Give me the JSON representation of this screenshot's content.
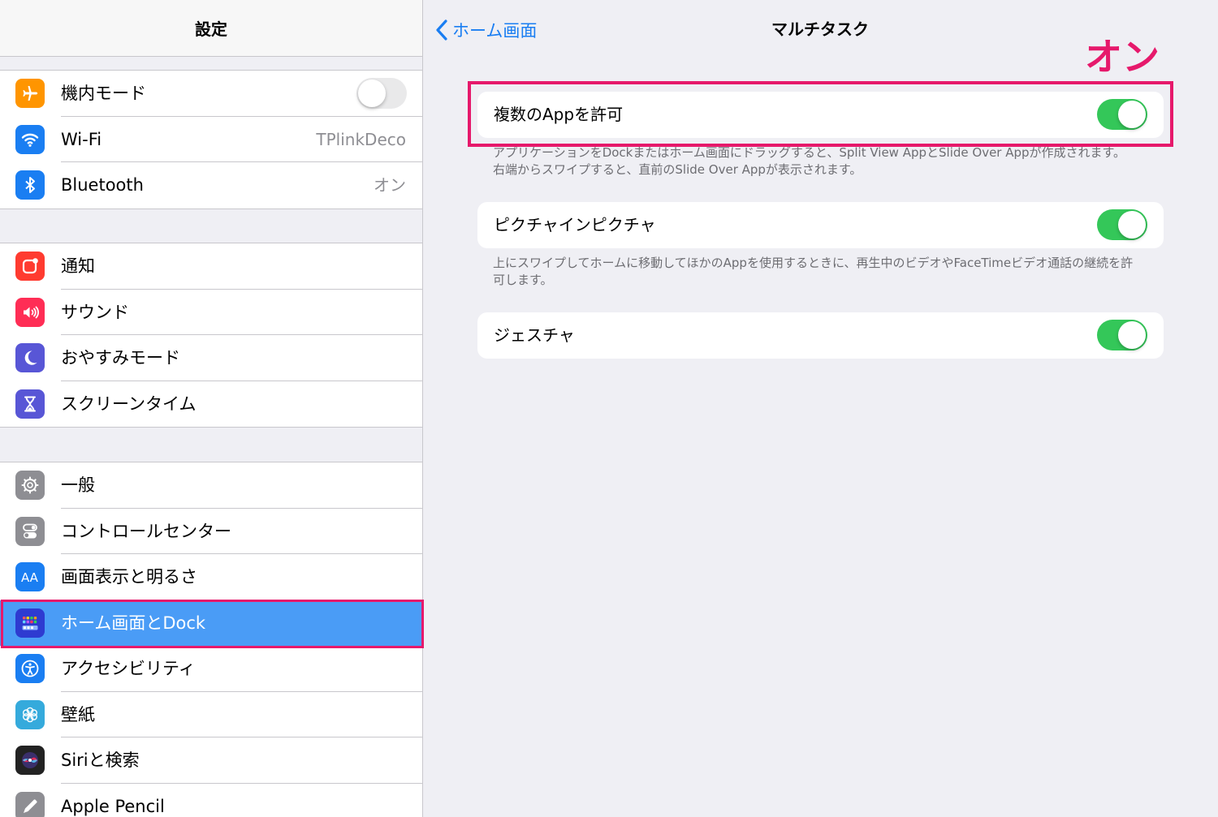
{
  "sidebar": {
    "title": "設定",
    "group1": [
      {
        "label": "機内モード",
        "icon": "airplane-icon",
        "color": "#ff9500",
        "toggle": "off"
      },
      {
        "label": "Wi-Fi",
        "icon": "wifi-icon",
        "color": "#1a7ef2",
        "value": "TPlinkDeco"
      },
      {
        "label": "Bluetooth",
        "icon": "bluetooth-icon",
        "color": "#1a7ef2",
        "value": "オン"
      }
    ],
    "group2": [
      {
        "label": "通知",
        "icon": "notifications-icon",
        "color": "#ff3b30"
      },
      {
        "label": "サウンド",
        "icon": "speaker-icon",
        "color": "#ff2d55"
      },
      {
        "label": "おやすみモード",
        "icon": "moon-icon",
        "color": "#5856d6"
      },
      {
        "label": "スクリーンタイム",
        "icon": "hourglass-icon",
        "color": "#5856d6"
      }
    ],
    "group3": [
      {
        "label": "一般",
        "icon": "gear-icon",
        "color": "#8e8e93"
      },
      {
        "label": "コントロールセンター",
        "icon": "switches-icon",
        "color": "#8e8e93"
      },
      {
        "label": "画面表示と明るさ",
        "icon": "text-size-icon",
        "color": "#1a7ef2"
      },
      {
        "label": "ホーム画面とDock",
        "icon": "home-grid-icon",
        "color": "#2e3bd1",
        "selected": true
      },
      {
        "label": "アクセシビリティ",
        "icon": "accessibility-icon",
        "color": "#1a7ef2"
      },
      {
        "label": "壁紙",
        "icon": "flower-icon",
        "color": "#35aadc"
      },
      {
        "label": "Siriと検索",
        "icon": "siri-icon",
        "color": "#222222"
      },
      {
        "label": "Apple Pencil",
        "icon": "pencil-icon",
        "color": "#8e8e93"
      }
    ]
  },
  "detail": {
    "back_label": "ホーム画面",
    "title": "マルチタスク",
    "annotation": "オン",
    "settings": [
      {
        "label": "複数のAppを許可",
        "toggle": "on",
        "footer": [
          "アプリケーションをDockまたはホーム画面にドラッグすると、Split View AppとSlide Over Appが作成されます。",
          "右端からスワイプすると、直前のSlide Over Appが表示されます。"
        ]
      },
      {
        "label": "ピクチャインピクチャ",
        "toggle": "on",
        "footer": [
          "上にスワイプしてホームに移動してほかのAppを使用するときに、再生中のビデオやFaceTimeビデオ通話の継続を許",
          "可します。"
        ]
      },
      {
        "label": "ジェスチャ",
        "toggle": "on"
      }
    ]
  },
  "colors": {
    "accent": "#1a7ef2",
    "selection": "#4a9cf6",
    "highlight": "#e6196b",
    "toggle_on": "#34c759"
  }
}
